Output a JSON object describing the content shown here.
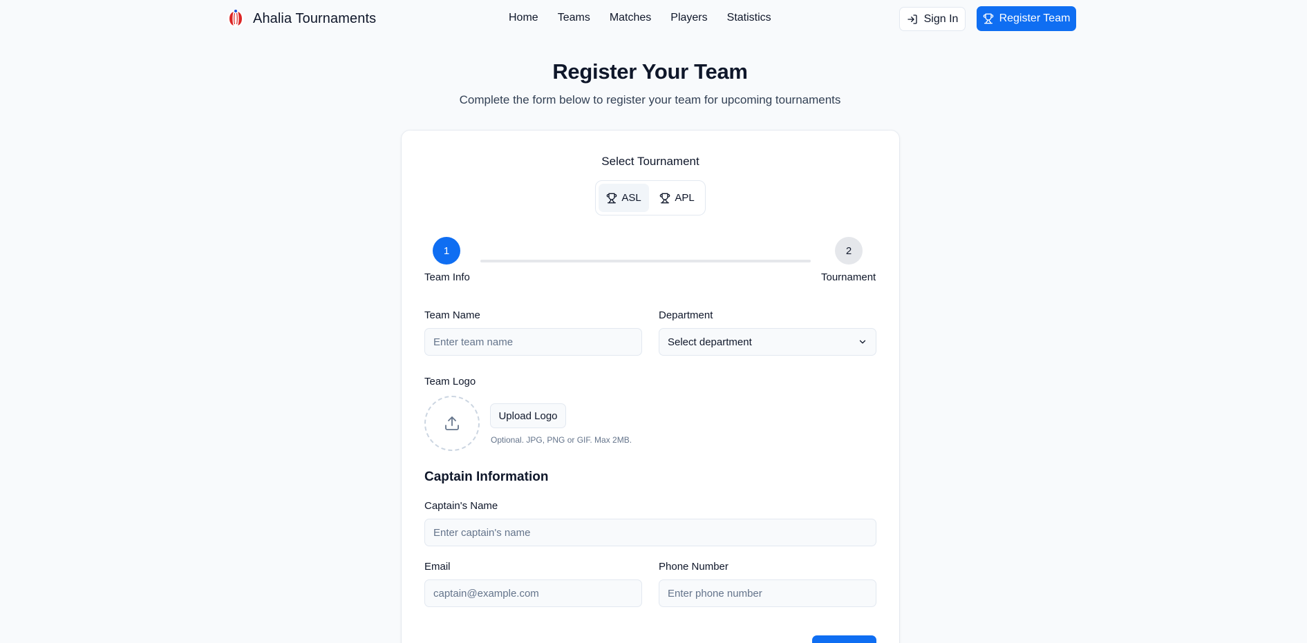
{
  "header": {
    "brand_name": "Ahalia Tournaments",
    "nav": [
      "Home",
      "Teams",
      "Matches",
      "Players",
      "Statistics"
    ],
    "sign_in_label": "Sign In",
    "register_label": "Register Team"
  },
  "hero": {
    "title": "Register Your Team",
    "subtitle": "Complete the form below to register your team for upcoming tournaments"
  },
  "tournament_select": {
    "label": "Select Tournament",
    "options": [
      "ASL",
      "APL"
    ],
    "selected": "ASL"
  },
  "stepper": {
    "steps": [
      {
        "number": "1",
        "label": "Team Info",
        "active": true
      },
      {
        "number": "2",
        "label": "Tournament",
        "active": false
      }
    ]
  },
  "form": {
    "team_name": {
      "label": "Team Name",
      "placeholder": "Enter team name"
    },
    "department": {
      "label": "Department",
      "value": "Select department"
    },
    "team_logo": {
      "label": "Team Logo",
      "button": "Upload Logo",
      "hint": "Optional. JPG, PNG or GIF. Max 2MB."
    },
    "captain_section": "Captain Information",
    "captain_name": {
      "label": "Captain's Name",
      "placeholder": "Enter captain's name"
    },
    "email": {
      "label": "Email",
      "placeholder": "captain@example.com"
    },
    "phone": {
      "label": "Phone Number",
      "placeholder": "Enter phone number"
    }
  },
  "icons": {
    "brand": "cricket-ball-icon",
    "sign_in": "log-in-icon",
    "register": "trophy-icon",
    "tournament_option": "trophy-icon",
    "upload": "upload-icon",
    "dropdown": "chevron-down-icon"
  },
  "colors": {
    "accent": "#0f6ef2",
    "page_background": "#f8fafc",
    "text": "#0f172a",
    "muted_text": "#64748b",
    "border": "#e2e8f0"
  }
}
